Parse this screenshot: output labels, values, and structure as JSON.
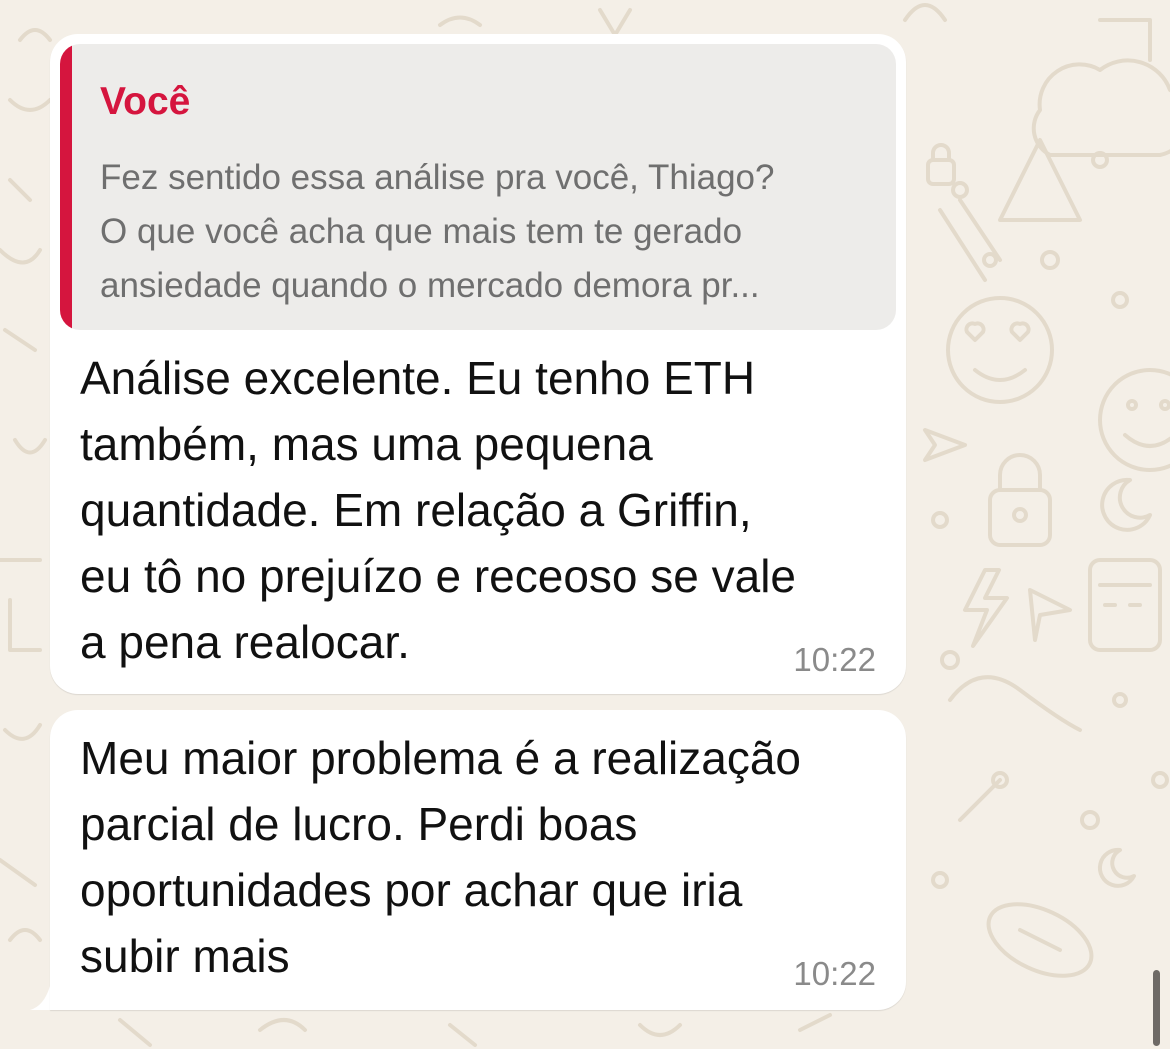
{
  "colors": {
    "background": "#f4efe7",
    "bubble": "#ffffff",
    "quote_background": "#edecea",
    "quote_accent": "#d5153e",
    "quote_text": "#6f6f6f",
    "message_text": "#111111",
    "timestamp": "#8a8a8a"
  },
  "background_icons": [
    "cloud-icon",
    "heart-eyes-icon",
    "smiley-icon",
    "lock-icon",
    "lightning-icon",
    "paper-plane-icon",
    "calculator-icon",
    "football-icon",
    "moon-icon",
    "palm-tree-icon"
  ],
  "messages": [
    {
      "quote": {
        "author": "Você",
        "lines": [
          "Fez sentido essa análise pra você, Thiago?",
          "O que você acha que mais tem te gerado",
          "ansiedade quando o mercado demora pr..."
        ]
      },
      "lines": [
        "Análise excelente. Eu tenho ETH",
        "também, mas uma pequena",
        "quantidade. Em relação a Griffin,",
        "eu tô no prejuízo e receoso se vale",
        "a pena realocar."
      ],
      "time": "10:22"
    },
    {
      "lines": [
        "Meu maior problema é a realização",
        "parcial de lucro. Perdi boas",
        "oportunidades por achar que iria",
        "subir mais"
      ],
      "time": "10:22"
    }
  ]
}
